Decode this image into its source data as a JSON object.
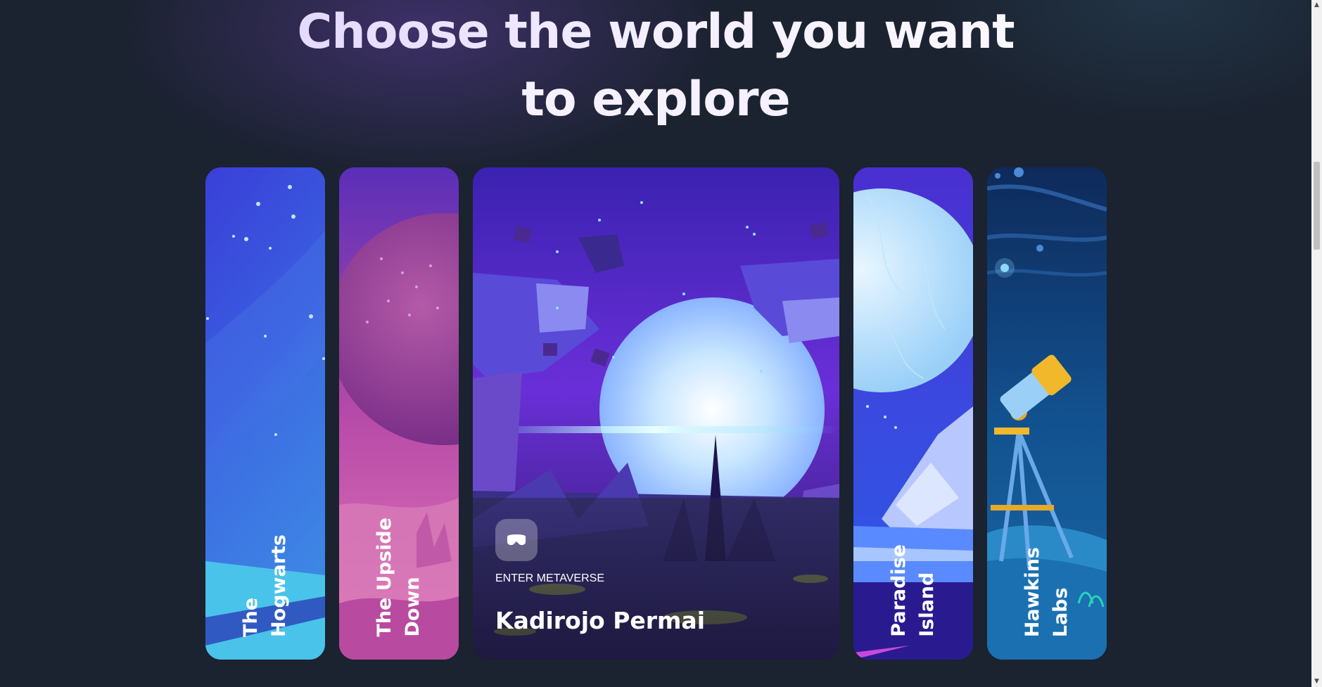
{
  "headline": {
    "line1": "Choose the world you want",
    "line2": "to explore"
  },
  "worlds": [
    {
      "label_line1": "The",
      "label_line2": "Hogwarts",
      "icon": "nebula-scene"
    },
    {
      "label_line1": "The Upside",
      "label_line2": "Down",
      "icon": "pink-planet-scene"
    },
    {
      "featured": true,
      "icon": "vr-headset-icon",
      "action_label": "ENTER METAVERSE",
      "title": "Kadirojo Permai"
    },
    {
      "label_line1": "Paradise",
      "label_line2": "Island",
      "icon": "moon-scene"
    },
    {
      "label_line1": "Hawkins",
      "label_line2": "Labs",
      "icon": "telescope-scene"
    }
  ],
  "colors": {
    "background": "#1b2230",
    "headline": "#f1ecff",
    "accent_purple": "#6a3cff",
    "accent_blue": "#2b6fe0"
  },
  "scrollbar": {
    "up_icon": "scroll-up-arrow",
    "down_icon": "scroll-down-arrow"
  }
}
